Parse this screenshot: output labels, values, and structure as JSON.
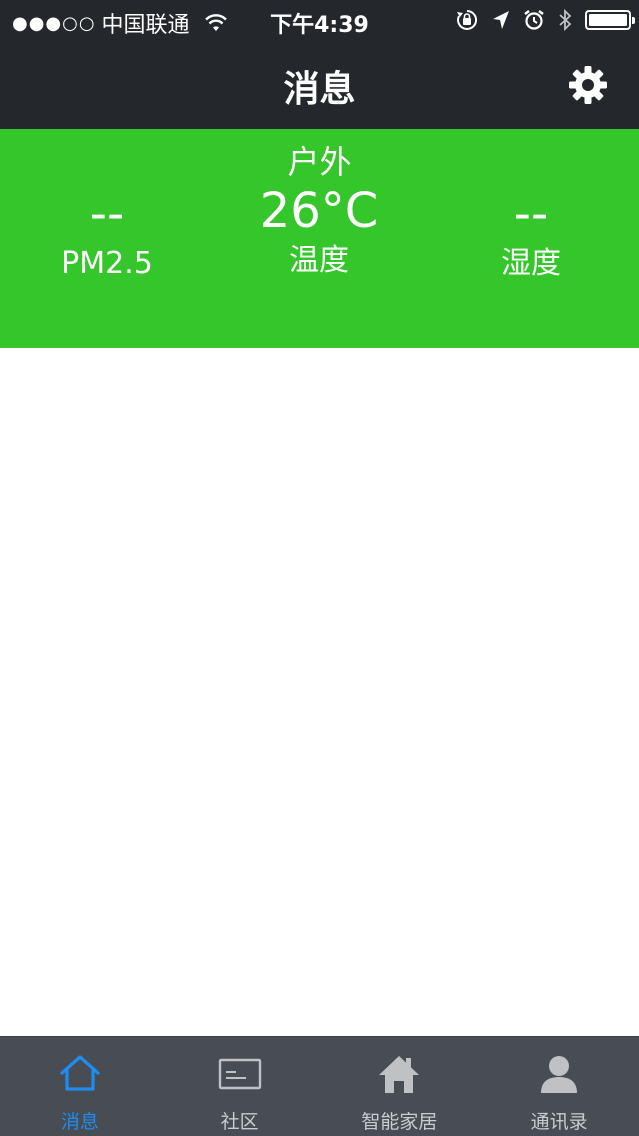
{
  "status_bar": {
    "signal": "●●●○○",
    "carrier": "中国联通",
    "time": "下午4:39"
  },
  "nav": {
    "title": "消息"
  },
  "weather": {
    "location": "户外",
    "pm25": {
      "value": "--",
      "label": "PM2.5"
    },
    "temperature": {
      "value": "26°C",
      "label": "温度"
    },
    "humidity": {
      "value": "--",
      "label": "湿度"
    },
    "color": "#34c62b"
  },
  "tabbar": {
    "tabs": [
      {
        "label": "消息",
        "icon": "home-outline-icon",
        "active": true
      },
      {
        "label": "社区",
        "icon": "card-icon",
        "active": false
      },
      {
        "label": "智能家居",
        "icon": "house-icon",
        "active": false
      },
      {
        "label": "通讯录",
        "icon": "person-icon",
        "active": false
      }
    ],
    "active_color": "#1e8cf0"
  }
}
